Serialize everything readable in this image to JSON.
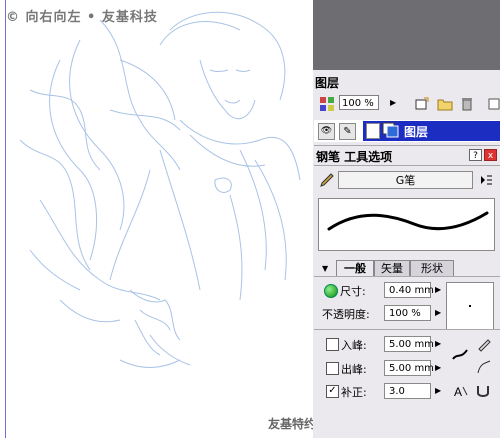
{
  "watermark": {
    "top": "© 向右向左 • 友基科技",
    "bottom": "友基特约教程 www.ugee.com.cn"
  },
  "layers_panel": {
    "title": "图层",
    "zoom": "100 %",
    "layer_name": "图层"
  },
  "tool_panel": {
    "title": "钢笔  工具选项",
    "help_label": "?",
    "close_label": "x",
    "brush_name": "G笔",
    "tabs": [
      "一般",
      "矢量",
      "形状"
    ],
    "size_label": "尺寸:",
    "size_value": "0.40 mm",
    "opacity_label": "不透明度:",
    "opacity_value": "100 %",
    "in_label": "入峰:",
    "in_value": "5.00 mm",
    "out_label": "出峰:",
    "out_value": "5.00 mm",
    "correction_label": "补正:",
    "correction_value": "3.0",
    "correction_checked": "✓"
  },
  "colors": {
    "selection_blue": "#1c2ec2",
    "sketch_blue": "#a9c3e6"
  }
}
